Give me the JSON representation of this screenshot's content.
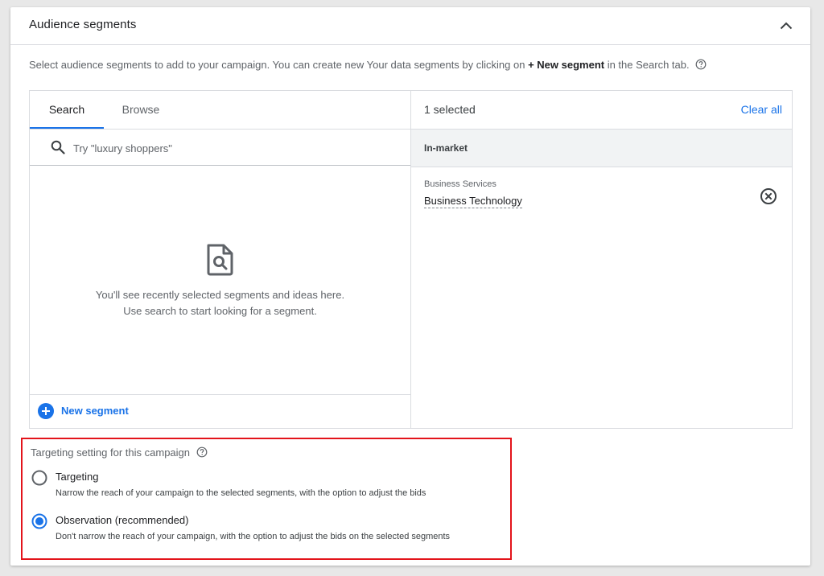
{
  "header": {
    "title": "Audience segments",
    "collapse_icon": "chevron-up-icon"
  },
  "description": {
    "before": "Select audience segments to add to your campaign. You can create new Your data segments by clicking on ",
    "bold": "+ New segment",
    "after": " in the Search tab."
  },
  "left": {
    "tabs": [
      {
        "label": "Search",
        "active": true
      },
      {
        "label": "Browse",
        "active": false
      }
    ],
    "search": {
      "placeholder": "Try \"luxury shoppers\"",
      "value": ""
    },
    "empty_state": {
      "line1": "You'll see recently selected segments and ideas here.",
      "line2": "Use search to start looking for a segment."
    },
    "new_segment_label": "New segment"
  },
  "right": {
    "selected_count": "1 selected",
    "clear_all_label": "Clear all",
    "group": "In-market",
    "items": [
      {
        "parent": "Business Services",
        "name": "Business Technology"
      }
    ]
  },
  "targeting": {
    "title": "Targeting setting for this campaign",
    "options": [
      {
        "label": "Targeting",
        "description": "Narrow the reach of your campaign to the selected segments, with the option to adjust the bids",
        "selected": false
      },
      {
        "label": "Observation (recommended)",
        "description": "Don't narrow the reach of your campaign, with the option to adjust the bids on the selected segments",
        "selected": true
      }
    ]
  },
  "colors": {
    "accent": "#1a73e8",
    "highlight_border": "#e3141b",
    "text_primary": "#202124",
    "text_secondary": "#5f6368"
  }
}
